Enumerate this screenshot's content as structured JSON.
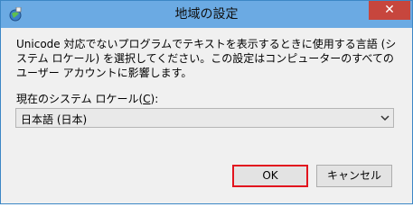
{
  "window": {
    "title": "地域の設定",
    "close_label": "✕"
  },
  "description": "Unicode 対応でないプログラムでテキストを表示するときに使用する言語 (システム ロケール) を選択してください。この設定はコンピューターのすべてのユーザー アカウントに影響します。",
  "locale": {
    "label_prefix": "現在のシステム ロケール(",
    "label_accel": "C",
    "label_suffix": "):",
    "selected_value": "日本語 (日本)"
  },
  "buttons": {
    "ok": "OK",
    "cancel": "キャンセル"
  },
  "colors": {
    "titlebar": "#6baae3",
    "close": "#c7463d",
    "ok_highlight": "#e2141e"
  }
}
